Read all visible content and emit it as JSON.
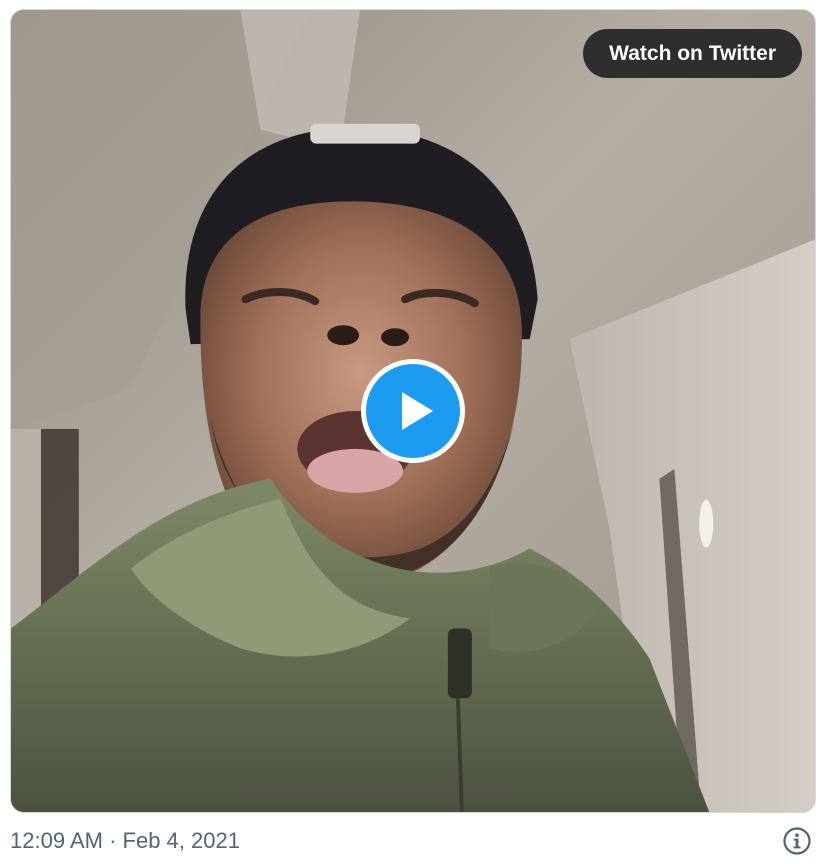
{
  "media": {
    "watch_label": "Watch on Twitter",
    "play_icon": "play-icon",
    "accent_color": "#1d9bf0"
  },
  "footer": {
    "time": "12:09 AM",
    "separator": " · ",
    "date": "Feb 4, 2021",
    "info_icon": "info-icon"
  }
}
